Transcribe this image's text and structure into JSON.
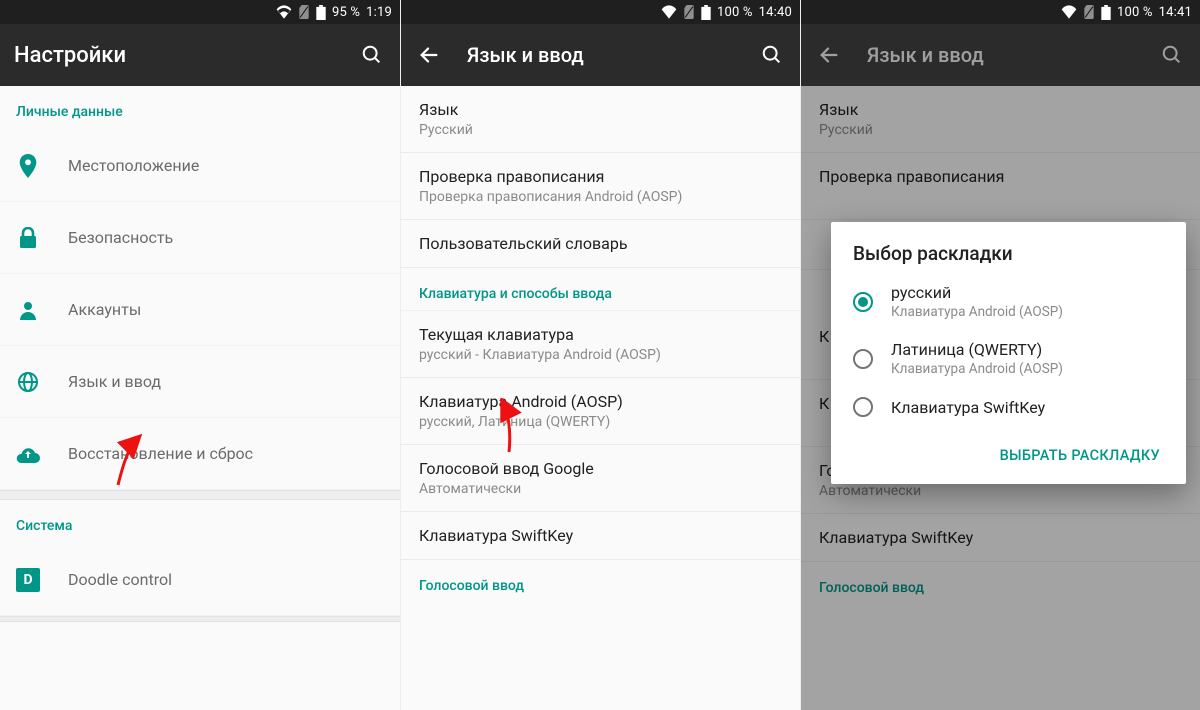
{
  "screen1": {
    "status": {
      "battery": "95 %",
      "time": "1:19"
    },
    "title": "Настройки",
    "section_personal": "Личные данные",
    "items": {
      "location": "Местоположение",
      "security": "Безопасность",
      "accounts": "Аккаунты",
      "language": "Язык и ввод",
      "backup": "Восстановление и сброс"
    },
    "section_system": "Система",
    "doodle": "Doodle control",
    "doodle_badge": "D"
  },
  "screen2": {
    "status": {
      "battery": "100 %",
      "time": "14:40"
    },
    "title": "Язык и ввод",
    "language": {
      "primary": "Язык",
      "secondary": "Русский"
    },
    "spell": {
      "primary": "Проверка правописания",
      "secondary": "Проверка правописания Android (AOSP)"
    },
    "dict": {
      "primary": "Пользовательский словарь"
    },
    "section_kbd": "Клавиатура и способы ввода",
    "current": {
      "primary": "Текущая клавиатура",
      "secondary": "русский - Клавиатура Android (AOSP)"
    },
    "aosp": {
      "primary": "Клавиатура Android (AOSP)",
      "secondary": "русский, Латиница (QWERTY)"
    },
    "gvoice": {
      "primary": "Голосовой ввод Google",
      "secondary": "Автоматически"
    },
    "swiftkey": {
      "primary": "Клавиатура SwiftKey"
    },
    "section_voice": "Голосовой ввод"
  },
  "screen3": {
    "status": {
      "battery": "100 %",
      "time": "14:41"
    },
    "title": "Язык и ввод",
    "bg": {
      "language": {
        "primary": "Язык",
        "secondary": "Русский"
      },
      "spell_primary": "Проверка правописания",
      "cur_primary": "К",
      "aosp_primary": "К",
      "gvoice": {
        "primary": "Голосовой ввод Google",
        "secondary": "Автоматически"
      },
      "swiftkey": {
        "primary": "Клавиатура SwiftKey"
      },
      "section_voice": "Голосовой ввод"
    },
    "dialog": {
      "title": "Выбор раскладки",
      "options": [
        {
          "primary": "русский",
          "secondary": "Клавиатура Android (AOSP)",
          "checked": true
        },
        {
          "primary": "Латиница (QWERTY)",
          "secondary": "Клавиатура Android (AOSP)",
          "checked": false
        },
        {
          "primary": "Клавиатура SwiftKey",
          "secondary": "",
          "checked": false
        }
      ],
      "action": "Выбрать раскладку"
    }
  }
}
